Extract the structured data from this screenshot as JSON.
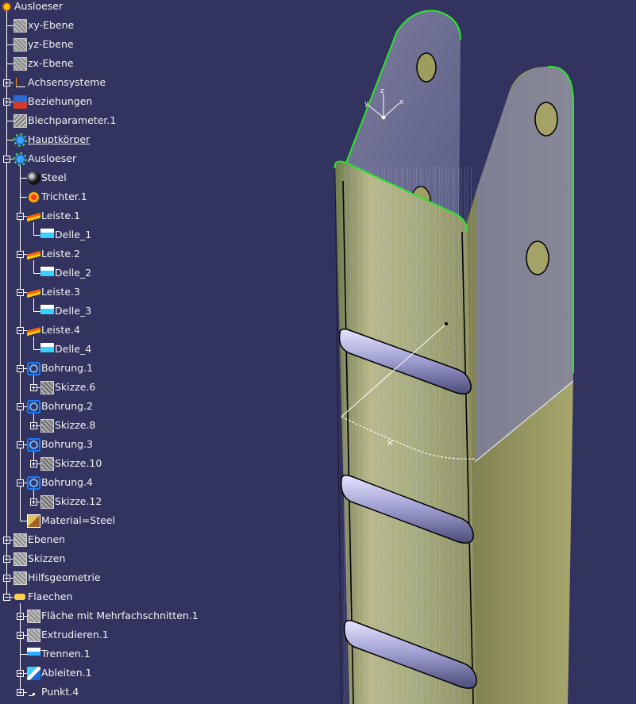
{
  "tree": {
    "items": [
      {
        "label": "Ausloeser",
        "icon": "part-root-icon"
      },
      {
        "label": "xy-Ebene",
        "icon": "plane-icon"
      },
      {
        "label": "yz-Ebene",
        "icon": "plane-icon"
      },
      {
        "label": "zx-Ebene",
        "icon": "plane-icon"
      },
      {
        "label": "Achsensysteme",
        "icon": "axis-system-icon"
      },
      {
        "label": "Beziehungen",
        "icon": "relations-icon"
      },
      {
        "label": "Blechparameter.1",
        "icon": "sheet-metal-parameters-icon"
      },
      {
        "label": "Hauptkörper",
        "icon": "body-gear-icon"
      },
      {
        "label": "Ausloeser",
        "icon": "body-gear-icon"
      },
      {
        "label": "Steel",
        "icon": "material-ball-icon"
      },
      {
        "label": "Trichter.1",
        "icon": "funnel-icon"
      },
      {
        "label": "Leiste.1",
        "icon": "rail-icon"
      },
      {
        "label": "Delle_1",
        "icon": "dent-icon"
      },
      {
        "label": "Leiste.2",
        "icon": "rail-icon"
      },
      {
        "label": "Delle_2",
        "icon": "dent-icon"
      },
      {
        "label": "Leiste.3",
        "icon": "rail-icon"
      },
      {
        "label": "Delle_3",
        "icon": "dent-icon"
      },
      {
        "label": "Leiste.4",
        "icon": "rail-icon"
      },
      {
        "label": "Delle_4",
        "icon": "dent-icon"
      },
      {
        "label": "Bohrung.1",
        "icon": "hole-icon"
      },
      {
        "label": "Skizze.6",
        "icon": "sketch-icon"
      },
      {
        "label": "Bohrung.2",
        "icon": "hole-icon"
      },
      {
        "label": "Skizze.8",
        "icon": "sketch-icon"
      },
      {
        "label": "Bohrung.3",
        "icon": "hole-icon"
      },
      {
        "label": "Skizze.10",
        "icon": "sketch-icon"
      },
      {
        "label": "Bohrung.4",
        "icon": "hole-icon"
      },
      {
        "label": "Skizze.12",
        "icon": "sketch-icon"
      },
      {
        "label": "Material=Steel",
        "icon": "material-icon"
      },
      {
        "label": "Ebenen",
        "icon": "planes-set-icon"
      },
      {
        "label": "Skizzen",
        "icon": "sketches-set-icon"
      },
      {
        "label": "Hilfsgeometrie",
        "icon": "construction-geometry-icon"
      },
      {
        "label": "Flaechen",
        "icon": "surfaces-set-icon"
      },
      {
        "label": "Fläche mit Mehrfachschnitten.1",
        "icon": "multi-section-surface-icon"
      },
      {
        "label": "Extrudieren.1",
        "icon": "extrude-icon"
      },
      {
        "label": "Trennen.1",
        "icon": "split-icon"
      },
      {
        "label": "Ableiten.1",
        "icon": "derive-icon"
      },
      {
        "label": "Punkt.4",
        "icon": "point-icon"
      }
    ]
  },
  "colors": {
    "background": "#33335f",
    "tree_text": "#f2f2f2",
    "part_face": "#8f8f45",
    "part_edge": "#000000",
    "highlight_edge": "#29e629"
  }
}
